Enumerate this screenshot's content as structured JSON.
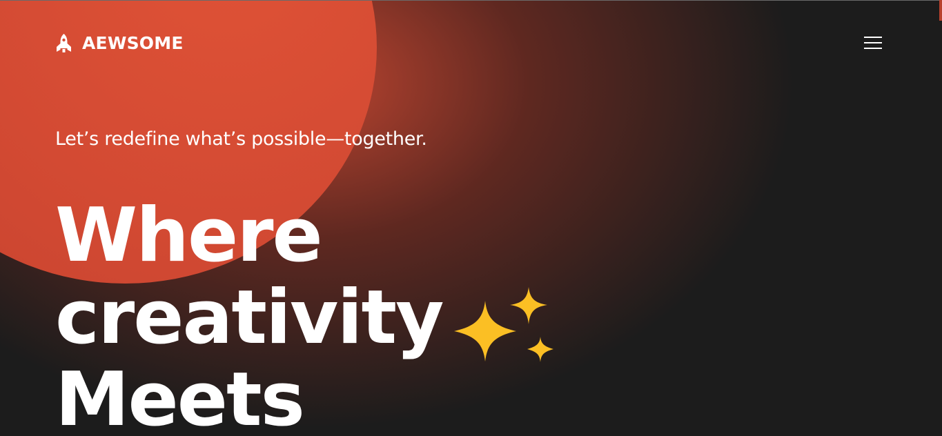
{
  "brand": {
    "name": "AEWSOME",
    "icon": "rocket-icon"
  },
  "nav": {
    "menu_icon": "hamburger-menu-icon"
  },
  "hero": {
    "tagline": "Let’s redefine what’s possible—together.",
    "headline_line1": "Where",
    "headline_line2": "creativity",
    "headline_line3": "Meets",
    "decoration_icon": "sparkles-icon"
  },
  "colors": {
    "background": "#1c1c1c",
    "accent_orange": "#da4d34",
    "sparkle_yellow": "#fbbf24",
    "text": "#ffffff"
  }
}
